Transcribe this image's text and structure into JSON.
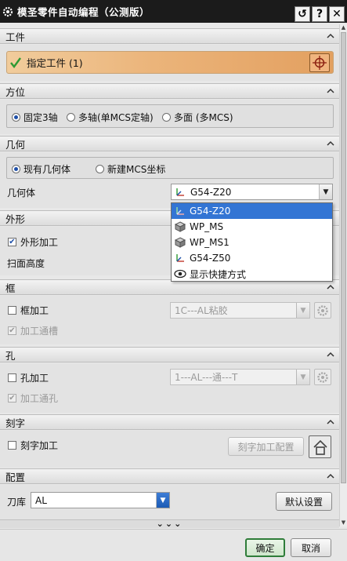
{
  "window": {
    "title": "模圣零件自动编程（公测版）"
  },
  "sections": {
    "workpiece": {
      "title": "工件",
      "specify_label": "指定工件 (1)"
    },
    "orientation": {
      "title": "方位",
      "options": [
        "固定3轴",
        "多轴(单MCS定轴)",
        "多面 (多MCS)"
      ],
      "selected": "固定3轴"
    },
    "geometry": {
      "title": "几何",
      "options": [
        "现有几何体",
        "新建MCS坐标"
      ],
      "selected": "现有几何体",
      "field_label": "几何体",
      "value": "G54-Z20",
      "dropdown_items": [
        "G54-Z20",
        "WP_MS",
        "WP_MS1",
        "G54-Z50",
        "显示快捷方式"
      ]
    },
    "profile": {
      "title": "外形",
      "checkbox_label": "外形加工",
      "checked": true,
      "scan_label": "扫面高度"
    },
    "frame": {
      "title": "框",
      "checkbox_label": "框加工",
      "sub_label": "加工通槽",
      "combo_value": "1C---AL粘胶"
    },
    "hole": {
      "title": "孔",
      "checkbox_label": "孔加工",
      "sub_label": "加工通孔",
      "combo_value": "1---AL---通---T"
    },
    "engrave": {
      "title": "刻字",
      "checkbox_label": "刻字加工",
      "config_button": "刻字加工配置"
    },
    "config": {
      "title": "配置",
      "tool_label": "刀库",
      "tool_value": "AL",
      "default_button": "默认设置"
    }
  },
  "more_indicator": "⌄⌄⌄",
  "footer": {
    "ok": "确定",
    "cancel": "取消"
  },
  "colors": {
    "title_bg": "#1b1b1b",
    "accent_orange": "#ebb47a",
    "selection_blue": "#3375d4",
    "ok_border": "#2f7d3a"
  }
}
